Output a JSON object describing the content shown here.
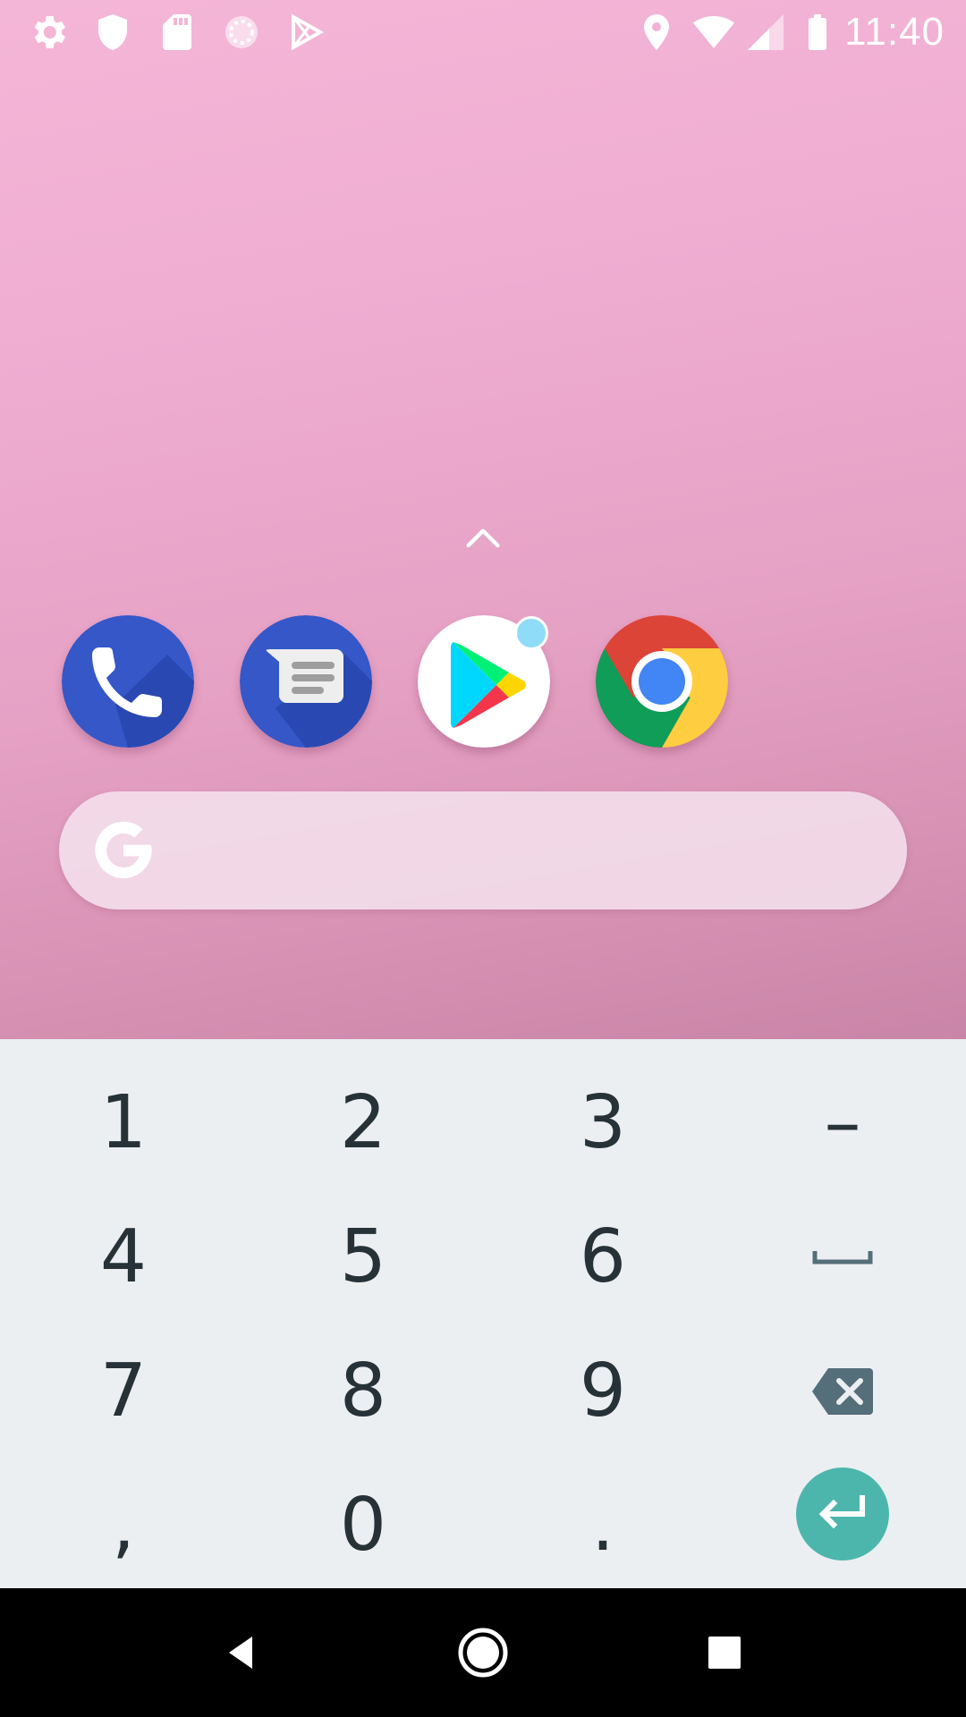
{
  "status_bar": {
    "time": "11:40",
    "left_icons": [
      "settings-icon",
      "shield-icon",
      "sd-card-icon",
      "sync-circle-icon",
      "play-store-icon"
    ],
    "right_icons": [
      "location-icon",
      "wifi-icon",
      "cellular-signal-icon",
      "battery-icon"
    ]
  },
  "home": {
    "hotseat": [
      {
        "app": "Phone",
        "icon": "phone-icon",
        "color": "#3557c8"
      },
      {
        "app": "Messages",
        "icon": "messages-icon",
        "color": "#3557c8"
      },
      {
        "app": "Play Store",
        "icon": "play-store-icon",
        "color": "#ffffff",
        "notification": true
      },
      {
        "app": "Chrome",
        "icon": "chrome-icon",
        "color": "#db4437"
      }
    ],
    "search_bar": {
      "icon": "google-g-icon"
    },
    "all_apps_icon": "chevron-up-icon"
  },
  "keyboard": {
    "type": "numeric",
    "rows": [
      [
        "1",
        "2",
        "3",
        "–"
      ],
      [
        "4",
        "5",
        "6",
        "space"
      ],
      [
        "7",
        "8",
        "9",
        "backspace"
      ],
      [
        ",",
        "0",
        ".",
        "enter"
      ]
    ],
    "keys": {
      "k1": "1",
      "k2": "2",
      "k3": "3",
      "dash": "–",
      "k4": "4",
      "k5": "5",
      "k6": "6",
      "k7": "7",
      "k8": "8",
      "k9": "9",
      "comma": ",",
      "k0": "0",
      "period": "."
    },
    "enter_color": "#4db6ac"
  },
  "nav_bar": {
    "buttons": [
      "back-icon",
      "home-icon",
      "recents-icon"
    ]
  }
}
